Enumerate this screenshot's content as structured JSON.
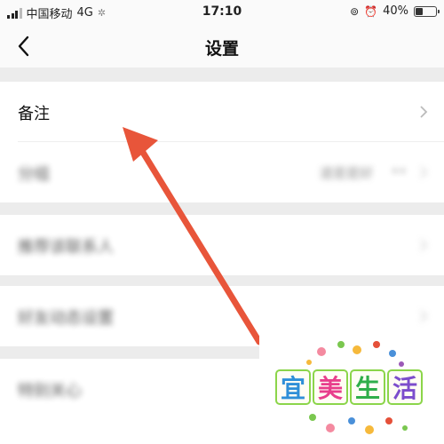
{
  "status_bar": {
    "carrier": "中国移动",
    "network": "4G",
    "time": "17:10",
    "battery": "40%",
    "battery_level": 0.4
  },
  "nav": {
    "title": "设置",
    "back_icon": "chevron-left-icon"
  },
  "rows": [
    {
      "label": "备注"
    },
    {
      "label": "分组",
      "value": "道是是好",
      "extra": "••"
    },
    {
      "label": "推荐该联系人"
    },
    {
      "label": "好友动态设置"
    },
    {
      "label": "特别关心"
    }
  ],
  "watermark": {
    "text": "宜美生活",
    "chars": [
      "宜",
      "美",
      "生",
      "活"
    ],
    "char_colors": [
      "#2f8fd8",
      "#e83e8c",
      "#2fae4a",
      "#7c4dcc"
    ]
  },
  "colors": {
    "arrow": "#e8553a",
    "background": "#ececec"
  }
}
